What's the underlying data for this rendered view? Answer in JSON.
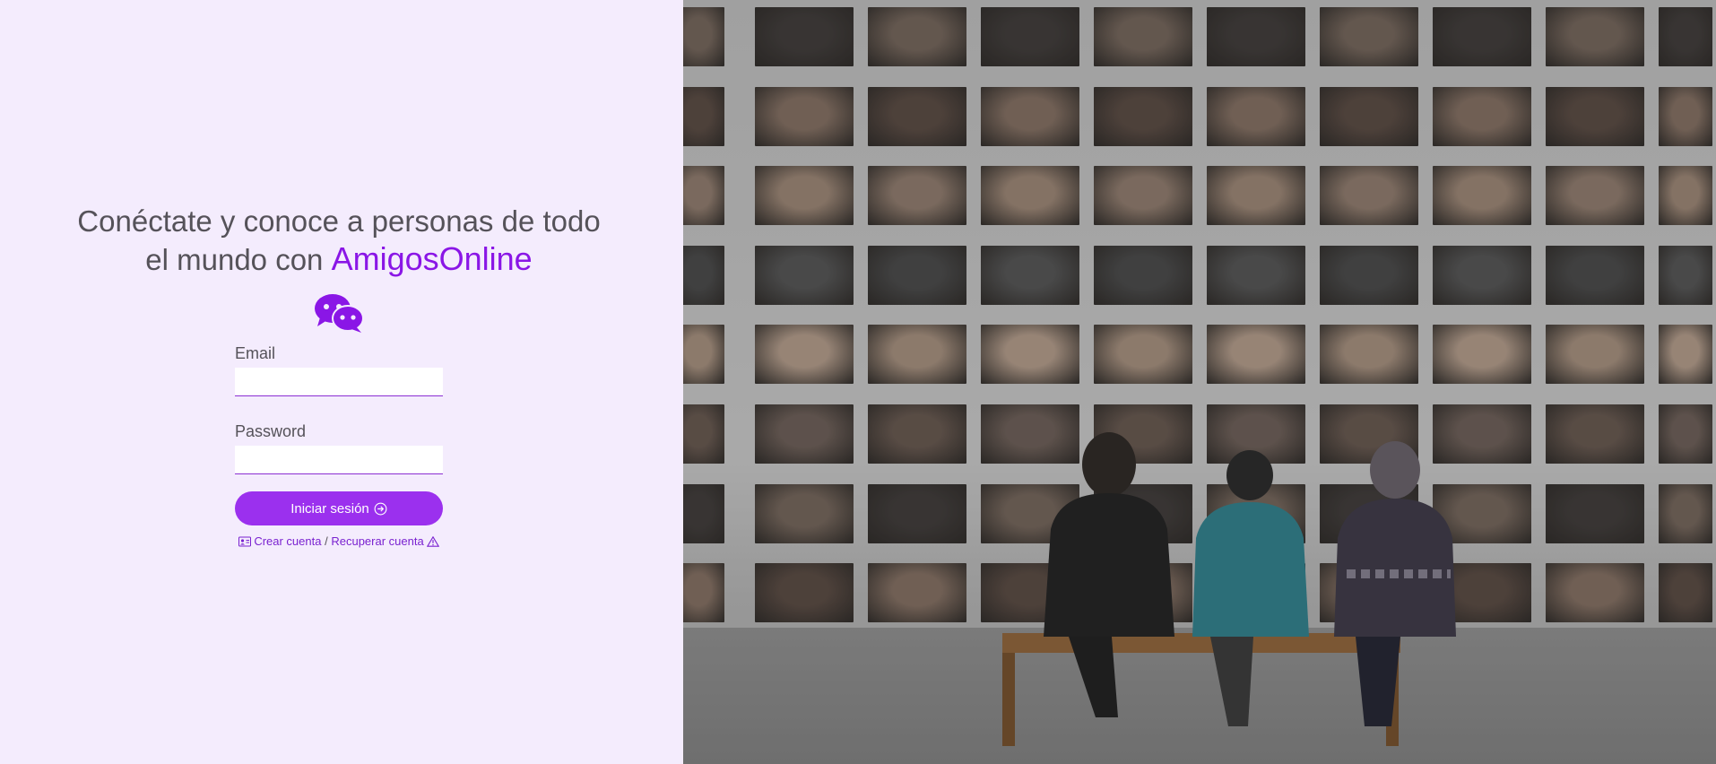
{
  "headline": {
    "line1": "Conéctate y conoce a personas de todo",
    "line2_prefix": "el mundo con",
    "brand": "AmigosOnline"
  },
  "logo": {
    "icon": "wechat-chat-bubbles-icon",
    "color": "#8a16e6"
  },
  "form": {
    "email_label": "Email",
    "email_value": "",
    "password_label": "Password",
    "password_value": "",
    "login_button": "Iniciar sesión",
    "login_icon": "arrow-circle-right-icon"
  },
  "links": {
    "create_icon": "id-card-icon",
    "create_account": "Crear cuenta",
    "separator": "/",
    "recover_account": "Recuperar cuenta",
    "recover_icon": "warning-triangle-icon"
  },
  "colors": {
    "accent": "#9b30ee",
    "brand": "#8a16e6",
    "panel_background": "#f4ecfd",
    "text": "#555259"
  },
  "hero_image": {
    "description_icon": "photo-wall-of-faces-image"
  }
}
